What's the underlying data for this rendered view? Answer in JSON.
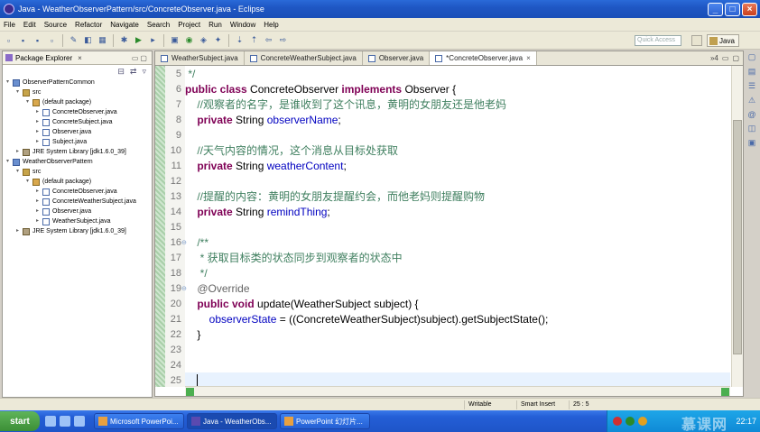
{
  "window": {
    "title": "Java - WeatherObserverPattern/src/ConcreteObserver.java - Eclipse",
    "min": "_",
    "max": "□",
    "close": "×"
  },
  "menu": [
    "File",
    "Edit",
    "Source",
    "Refactor",
    "Navigate",
    "Search",
    "Project",
    "Run",
    "Window",
    "Help"
  ],
  "toolbar": {
    "quick_access_placeholder": "Quick Access",
    "perspective": "Java"
  },
  "explorer": {
    "tab_label": "Package Explorer",
    "tree": [
      {
        "label": "ObserverPatternCommon",
        "level": 0,
        "icon": "project",
        "twist": "▾"
      },
      {
        "label": "src",
        "level": 1,
        "icon": "src",
        "twist": "▾"
      },
      {
        "label": "(default package)",
        "level": 2,
        "icon": "pkg",
        "twist": "▾"
      },
      {
        "label": "ConcreteObserver.java",
        "level": 3,
        "icon": "java",
        "twist": "▸"
      },
      {
        "label": "ConcreteSubject.java",
        "level": 3,
        "icon": "java",
        "twist": "▸"
      },
      {
        "label": "Observer.java",
        "level": 3,
        "icon": "java",
        "twist": "▸"
      },
      {
        "label": "Subject.java",
        "level": 3,
        "icon": "java",
        "twist": "▸"
      },
      {
        "label": "JRE System Library [jdk1.6.0_39]",
        "level": 1,
        "icon": "jre",
        "twist": "▸"
      },
      {
        "label": "WeatherObserverPattern",
        "level": 0,
        "icon": "project",
        "twist": "▾"
      },
      {
        "label": "src",
        "level": 1,
        "icon": "src",
        "twist": "▾"
      },
      {
        "label": "(default package)",
        "level": 2,
        "icon": "pkg",
        "twist": "▾"
      },
      {
        "label": "ConcreteObserver.java",
        "level": 3,
        "icon": "java",
        "twist": "▸"
      },
      {
        "label": "ConcreteWeatherSubject.java",
        "level": 3,
        "icon": "java",
        "twist": "▸"
      },
      {
        "label": "Observer.java",
        "level": 3,
        "icon": "java",
        "twist": "▸"
      },
      {
        "label": "WeatherSubject.java",
        "level": 3,
        "icon": "java",
        "twist": "▸"
      },
      {
        "label": "JRE System Library [jdk1.6.0_39]",
        "level": 1,
        "icon": "jre",
        "twist": "▸"
      }
    ]
  },
  "editor": {
    "tabs": [
      {
        "label": "WeatherSubject.java",
        "active": false
      },
      {
        "label": "ConcreteWeatherSubject.java",
        "active": false
      },
      {
        "label": "Observer.java",
        "active": false
      },
      {
        "label": "*ConcreteObserver.java",
        "active": true
      }
    ],
    "tabs_overflow": "»4",
    "lines": [
      {
        "n": "5",
        "parts": [
          [
            "cm",
            " */"
          ]
        ]
      },
      {
        "n": "6",
        "parts": [
          [
            "kw",
            "public class "
          ],
          [
            "",
            "ConcreteObserver "
          ],
          [
            "kw",
            "implements "
          ],
          [
            "",
            "Observer {"
          ]
        ]
      },
      {
        "n": "7",
        "parts": [
          [
            "cm",
            "    //观察者的名字，是谁收到了这个讯息，黄明的女朋友还是他老妈"
          ]
        ]
      },
      {
        "n": "8",
        "parts": [
          [
            "kw",
            "    private "
          ],
          [
            "",
            "String "
          ],
          [
            "fld",
            "observerName"
          ],
          [
            "",
            ";"
          ]
        ]
      },
      {
        "n": "9",
        "parts": [
          [
            "",
            ""
          ]
        ]
      },
      {
        "n": "10",
        "parts": [
          [
            "cm",
            "    //天气内容的情况，这个消息从目标处获取"
          ]
        ]
      },
      {
        "n": "11",
        "parts": [
          [
            "kw",
            "    private "
          ],
          [
            "",
            "String "
          ],
          [
            "fld",
            "weatherContent"
          ],
          [
            "",
            ";"
          ]
        ]
      },
      {
        "n": "12",
        "parts": [
          [
            "",
            ""
          ]
        ]
      },
      {
        "n": "13",
        "parts": [
          [
            "cm",
            "    //提醒的内容：黄明的女朋友提醒约会，而他老妈则提醒购物"
          ]
        ]
      },
      {
        "n": "14",
        "parts": [
          [
            "kw",
            "    private "
          ],
          [
            "",
            "String "
          ],
          [
            "fld",
            "remindThing"
          ],
          [
            "",
            ";"
          ]
        ]
      },
      {
        "n": "15",
        "parts": [
          [
            "",
            ""
          ]
        ]
      },
      {
        "n": "16",
        "parts": [
          [
            "cm",
            "    /**"
          ]
        ]
      },
      {
        "n": "17",
        "parts": [
          [
            "cm",
            "     * 获取目标类的状态同步到观察者的状态中"
          ]
        ]
      },
      {
        "n": "18",
        "parts": [
          [
            "cm",
            "     */"
          ]
        ]
      },
      {
        "n": "19",
        "parts": [
          [
            "ann",
            "    @Override"
          ]
        ]
      },
      {
        "n": "20",
        "parts": [
          [
            "kw",
            "    public void "
          ],
          [
            "",
            "update(WeatherSubject subject) {"
          ]
        ]
      },
      {
        "n": "21",
        "parts": [
          [
            "",
            "        "
          ],
          [
            "fld",
            "observerState"
          ],
          [
            "",
            " = ((ConcreteWeatherSubject)subject).getSubjectState();"
          ]
        ]
      },
      {
        "n": "22",
        "parts": [
          [
            "",
            "    }"
          ]
        ]
      },
      {
        "n": "23",
        "parts": [
          [
            "",
            ""
          ]
        ]
      },
      {
        "n": "24",
        "parts": [
          [
            "",
            ""
          ]
        ]
      },
      {
        "n": "25",
        "parts": [
          [
            "",
            "    "
          ]
        ]
      }
    ]
  },
  "status": {
    "writable": "Writable",
    "insert_mode": "Smart Insert",
    "position": "25 : 5"
  },
  "taskbar": {
    "start": "start",
    "tasks": [
      {
        "label": "Microsoft PowerPoi...",
        "active": false
      },
      {
        "label": "Java - WeatherObs...",
        "active": true
      },
      {
        "label": "PowerPoint 幻灯片...",
        "active": false
      }
    ],
    "watermark": "慕课网",
    "clock": "22:17"
  }
}
